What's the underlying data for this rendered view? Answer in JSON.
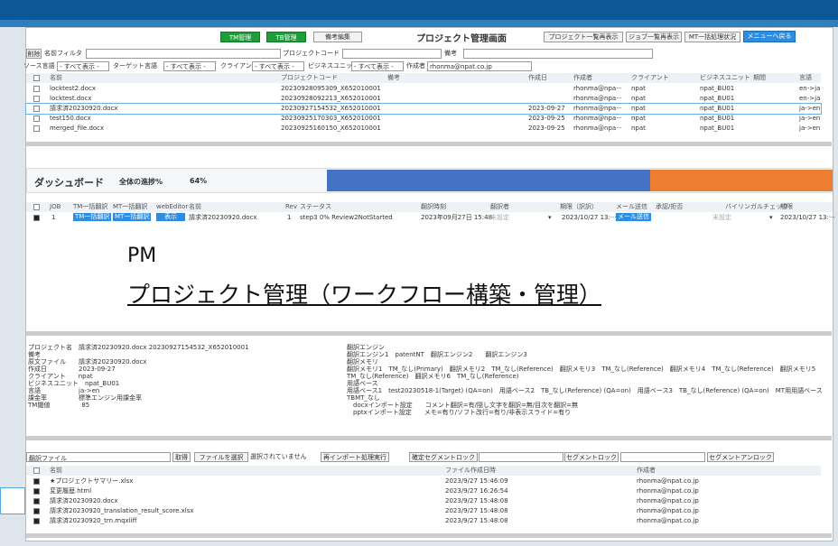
{
  "header": {
    "tm_admin": "TM管理",
    "tb_admin": "TB管理",
    "memo_edit": "備考編集",
    "title": "プロジェクト管理画面",
    "proj_list": "プロジェクト一覧再表示",
    "job_list": "ジョブ一覧再表示",
    "mt_status": "MT一括処理状況",
    "back_menu": "メニューへ戻る"
  },
  "filter1": {
    "delete": "削除",
    "name_filter": "名前フィルタ",
    "project_code": "プロジェクトコード",
    "memo": "備考"
  },
  "filter2": {
    "source_lang": "ソース言語",
    "source_val": "- すべて表示 -",
    "target_lang": "ターゲット言語",
    "target_val": "- すべて表示 -",
    "client": "クライアント",
    "client_val": "- すべて表示 -",
    "bu": "ビジネスユニット",
    "bu_val": "- すべて表示 -",
    "author": "作成者",
    "author_val": "rhonma@npat.co.jp"
  },
  "files": {
    "headers": [
      "名前",
      "プロジェクトコード",
      "備考",
      "作成日",
      "作成者",
      "クライアント",
      "ビジネスユニット",
      "期間",
      "言語"
    ],
    "rows": [
      {
        "name": "locktest2.docx",
        "code": "20230928095309_X652010001",
        "date": "",
        "author": "rhonma@npa···",
        "client": "npat",
        "bu": "npat_BU01",
        "lang": "en->ja"
      },
      {
        "name": "locktest.docx",
        "code": "20230928092213_X652010001",
        "date": "",
        "author": "rhonma@npa···",
        "client": "npat",
        "bu": "npat_BU01",
        "lang": "en->ja"
      },
      {
        "name": "請求済20230920.docx",
        "code": "20230927154532_X652010001",
        "date": "2023-09-27",
        "author": "rhonma@npa···",
        "client": "npat",
        "bu": "npat_BU01",
        "lang": "ja->en"
      },
      {
        "name": "test150.docx",
        "code": "20230925170303_X652010001",
        "date": "2023-09-25",
        "author": "rhonma@npa···",
        "client": "npat",
        "bu": "npat_BU01",
        "lang": "ja->en"
      },
      {
        "name": "merged_file.docx",
        "code": "20230925160150_X652010001",
        "date": "2023-09-25",
        "author": "rhonma@npa···",
        "client": "npat",
        "bu": "npat_BU01",
        "lang": "ja->en"
      }
    ]
  },
  "dashboard": {
    "title": "ダッシュボード",
    "progress_label": "全体の進捗%",
    "progress_value": "64%",
    "progress": 0.64,
    "bar_blue": "#4472c4",
    "bar_orange": "#ed7d31"
  },
  "jobs": {
    "headers": [
      "JOB",
      "TM一括翻訳",
      "MT一括翻訳",
      "webEditor",
      "名前",
      "Rev",
      "ステータス",
      "翻訳時刻",
      "翻訳者",
      "期限（訳訳）",
      "メール送信",
      "承認/拒否",
      "バイリンガルチェック",
      "期限"
    ],
    "row": {
      "job": "1",
      "tm": "TM一括翻訳",
      "mt": "MT一括翻訳",
      "view": "表示",
      "name": "請求済20230920.docx",
      "rev": "1",
      "status": "step3 0% Review2NotStarted",
      "time": "2023年09月27日 15:48",
      "translator": "未設定",
      "deadline": "2023/10/27 13:···",
      "mail": "メール送信",
      "bili": "未設定",
      "deadline2": "2023/10/27 13:···"
    }
  },
  "overlay": {
    "line1": "PM",
    "line2": "プロジェクト管理（ワークフロー構築・管理）"
  },
  "detail_left": [
    "プロジェクト名　請求済20230920.docx 20230927154532_X652010001",
    "備考",
    "原文ファイル　　請求済20230920.docx",
    "作成日　　　　　2023-09-27",
    "クライアント　　npat",
    "ビジネスユニット　npat_BU01",
    "言語　　　　　　ja->en",
    "課金率　　　　　標準エンジン用課金率",
    "TM閾値　　　　　85"
  ],
  "detail_right": [
    "翻訳エンジン",
    "翻訳エンジン1　patentNT　翻訳エンジン2　　翻訳エンジン3",
    "翻訳メモリ",
    "翻訳メモリ1　TM_なし(Primary)　翻訳メモリ2　TM_なし(Reference)　翻訳メモリ3　TM_なし(Reference)　翻訳メモリ4　TM_なし(Reference)　翻訳メモリ5",
    "TM_なし(Reference)　翻訳メモリ6　TM_なし(Reference)",
    "用語ベース",
    "用語ベース1　test20230518-1(Target) (QA=on)　用語ベース2　TB_なし(Reference) (QA=on)　用語ベース3　TB_なし(Reference) (QA=on)　MT用用語ベース",
    "TBMT_なし",
    "　docxインポート設定　　コメント翻訳=有/隠し文字を翻訳=無/目次を翻訳=無",
    "　pptxインポート設定　　メモ=有り/ソフト改行=有り/非表示スライド=有り"
  ],
  "filebar": {
    "select": "翻訳ファイル",
    "get": "取得",
    "choose": "ファイルを選択",
    "none": "選択されていません",
    "reimport": "再インポート処理実行",
    "confirm_lock": "確定セグメントロック",
    "seg_lock": "セグメントロック",
    "seg_unlock": "セグメントアンロック"
  },
  "bottom": {
    "headers": [
      "名前",
      "ファイル作成日時",
      "作成者"
    ],
    "rows": [
      {
        "name": "★プロジェクトサマリー.xlsx",
        "date": "2023/9/27 15:46:09",
        "author": "rhonma@npat.co.jp"
      },
      {
        "name": "変更履歴.html",
        "date": "2023/9/27 16:26:54",
        "author": "rhonma@npat.co.jp"
      },
      {
        "name": "請求済20230920.docx",
        "date": "2023/9/27 15:48:08",
        "author": "rhonma@npat.co.jp"
      },
      {
        "name": "請求済20230920_translation_result_score.xlsx",
        "date": "2023/9/27 15:48:08",
        "author": "rhonma@npat.co.jp"
      },
      {
        "name": "請求済20230920_trn.mqxliff",
        "date": "2023/9/27 15:48:08",
        "author": "rhonma@npat.co.jp"
      }
    ]
  }
}
